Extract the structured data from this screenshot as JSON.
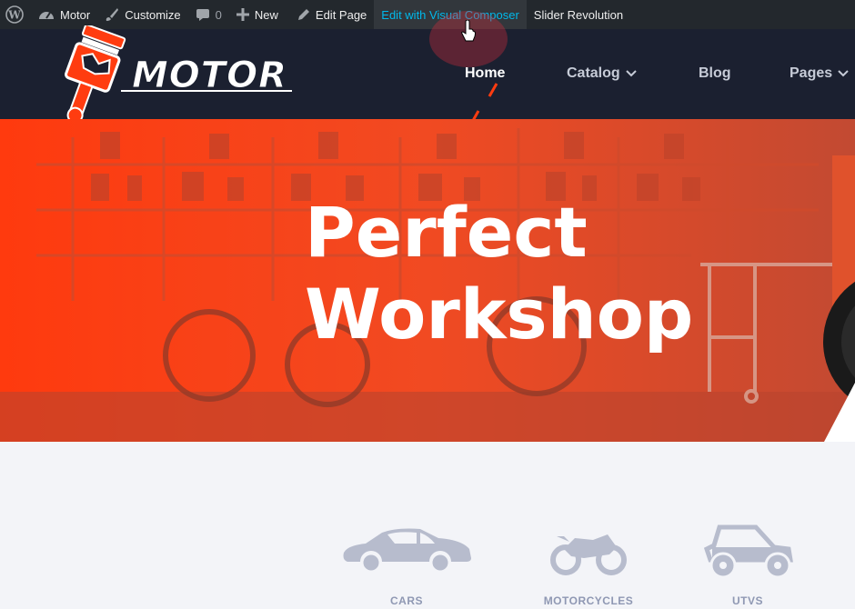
{
  "adminbar": {
    "items": [
      {
        "label": "",
        "icon": "wordpress-icon"
      },
      {
        "label": "Motor",
        "icon": "dashboard-icon"
      },
      {
        "label": "Customize",
        "icon": "brush-icon"
      },
      {
        "label": "0",
        "icon": "comment-icon"
      },
      {
        "label": "New",
        "icon": "plus-icon"
      },
      {
        "label": "Edit Page",
        "icon": "pencil-icon"
      },
      {
        "label": "Edit with Visual Composer",
        "icon": ""
      },
      {
        "label": "Slider Revolution",
        "icon": ""
      }
    ]
  },
  "header": {
    "logo_text": "MOTOR",
    "nav": [
      {
        "label": "Home",
        "has_dropdown": false,
        "active": true
      },
      {
        "label": "Catalog",
        "has_dropdown": true
      },
      {
        "label": "Blog",
        "has_dropdown": false
      },
      {
        "label": "Pages",
        "has_dropdown": true
      }
    ]
  },
  "hero": {
    "title_line1": "Perfect",
    "title_line2": "Workshop"
  },
  "categories": [
    {
      "label": "CARS",
      "icon": "car-icon"
    },
    {
      "label": "MOTORCYCLES",
      "icon": "motorcycle-icon"
    },
    {
      "label": "UTVS",
      "icon": "utv-icon"
    }
  ],
  "colors": {
    "accent": "#ff3c10",
    "header_bg": "#1b2030",
    "adminbar_bg": "#23282d",
    "active_link": "#00b9eb",
    "category_gray": "#b7bccd"
  }
}
